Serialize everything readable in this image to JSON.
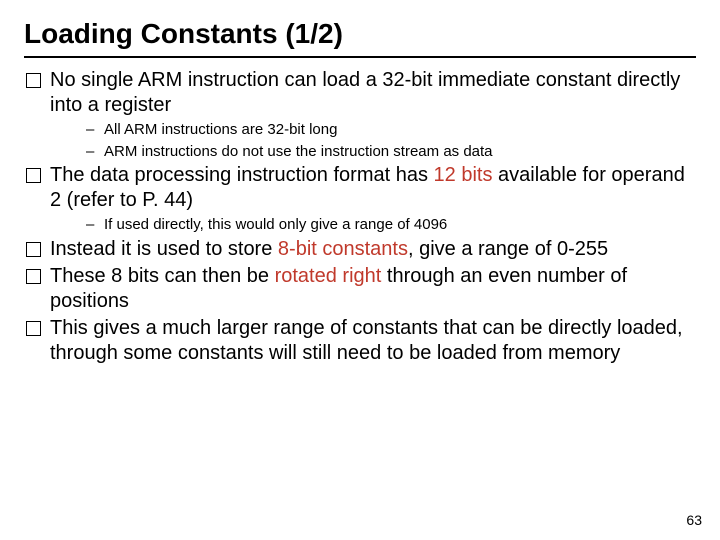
{
  "title": "Loading Constants (1/2)",
  "bullets": {
    "b1": "No single ARM instruction can load a 32-bit immediate constant directly into a register",
    "b1_sub1": "All ARM instructions are 32-bit long",
    "b1_sub2": "ARM instructions do not use the instruction stream as data",
    "b2_pre": "The data processing instruction format has ",
    "b2_hl": "12 bits",
    "b2_post": " available for operand 2 (refer to P. 44)",
    "b2_sub1": "If used directly, this would only give a range of 4096",
    "b3_pre": "Instead it is used to store ",
    "b3_hl": "8-bit constants",
    "b3_post": ", give a range of 0-255",
    "b4_pre": "These 8 bits can then be ",
    "b4_hl": "rotated right",
    "b4_post": " through an even number of positions",
    "b5": "This gives a much larger range of constants that can be directly loaded, through some constants will still need to be loaded from memory"
  },
  "page_number": "63"
}
